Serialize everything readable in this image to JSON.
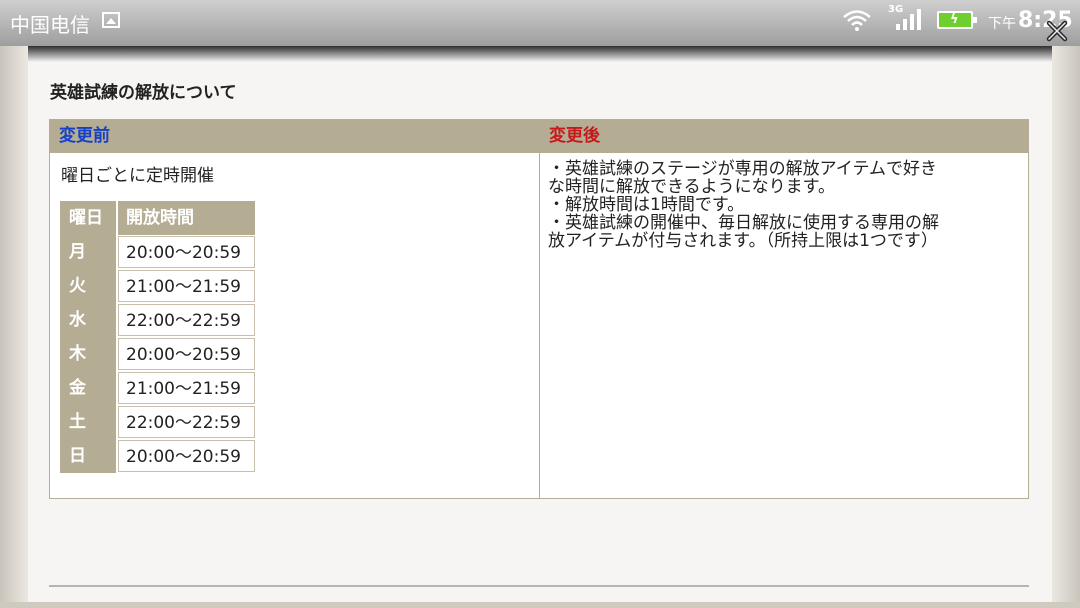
{
  "status_bar": {
    "carrier": "中国电信",
    "network": "3G",
    "time_prefix": "下午",
    "time": "8:25"
  },
  "page": {
    "title": "英雄試練の解放について"
  },
  "compare": {
    "before_header": "変更前",
    "after_header": "変更後",
    "before_description": "曜日ごとに定時開催",
    "schedule": {
      "header_day": "曜日",
      "header_time": "開放時間",
      "rows": [
        {
          "day": "月",
          "time": "20:00～20:59"
        },
        {
          "day": "火",
          "time": "21:00～21:59"
        },
        {
          "day": "水",
          "time": "22:00～22:59"
        },
        {
          "day": "木",
          "time": "20:00～20:59"
        },
        {
          "day": "金",
          "time": "21:00～21:59"
        },
        {
          "day": "土",
          "time": "22:00～22:59"
        },
        {
          "day": "日",
          "time": "20:00～20:59"
        }
      ]
    },
    "after_lines": [
      "・英雄試練のステージが専用の解放アイテムで好き",
      "な時間に解放できるようになります。",
      "・解放時間は1時間です。",
      "・英雄試練の開催中、毎日解放に使用する専用の解",
      "放アイテムが付与されます。（所持上限は1つです）"
    ]
  },
  "colors": {
    "header_bg": "#b5ac94",
    "before_header_text": "#1541c4",
    "after_header_text": "#c41a1a"
  }
}
